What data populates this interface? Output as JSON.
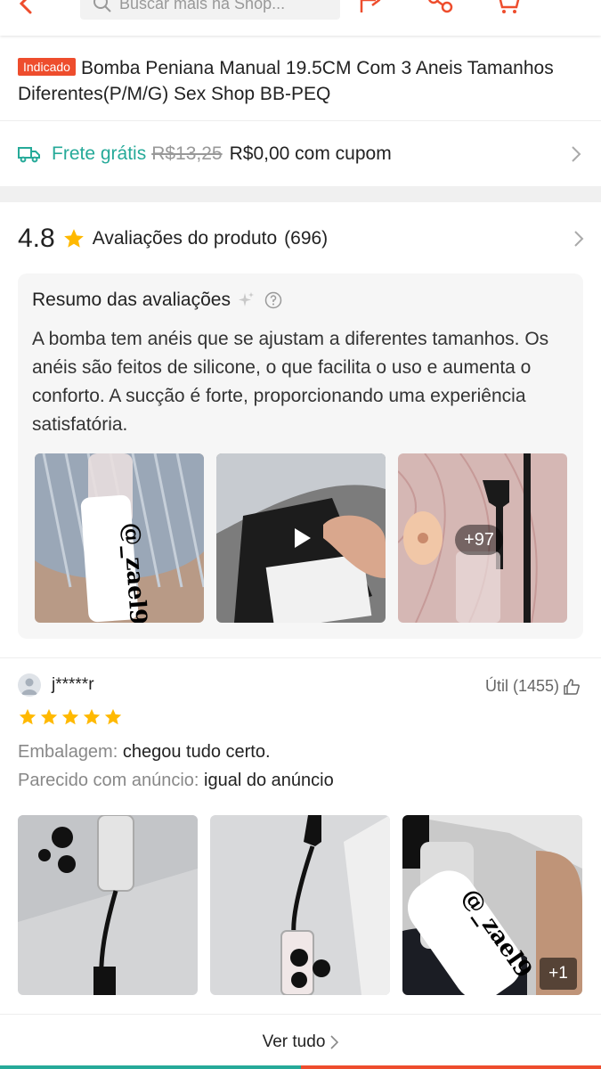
{
  "header": {
    "search_placeholder": "Buscar mais na Shop..."
  },
  "product": {
    "badge": "Indicado",
    "title": "Bomba Peniana Manual 19.5CM Com 3 Aneis Tamanhos Diferentes(P/M/G) Sex Shop BB-PEQ"
  },
  "shipping": {
    "free_label": "Frete grátis",
    "old_price": "R$13,25",
    "coupon_text": "R$0,00 com cupom"
  },
  "ratings": {
    "score": "4.8",
    "label": "Avaliações do produto",
    "count": "(696)"
  },
  "summary": {
    "title": "Resumo das avaliações",
    "text": "A bomba tem anéis que se ajustam a diferentes tamanhos. Os anéis são feitos de silicone, o que facilita o uso e aumenta o conforto. A sucção é forte, proporcionando uma experiência satisfatória.",
    "more_count": "+97",
    "watermark": "@_zael9"
  },
  "review": {
    "username": "j*****r",
    "useful_label": "Útil (1455)",
    "rating_stars": 5,
    "packaging_key": "Embalagem:",
    "packaging_value": "chegou tudo certo.",
    "similar_key": "Parecido com anúncio:",
    "similar_value": "igual do anúncio",
    "more_photos": "+1",
    "watermark": "@_zael9"
  },
  "footer": {
    "see_all": "Ver tudo"
  },
  "colors": {
    "brand": "#ee4d2d",
    "free_shipping": "#26aa99",
    "star": "#ffb900"
  }
}
